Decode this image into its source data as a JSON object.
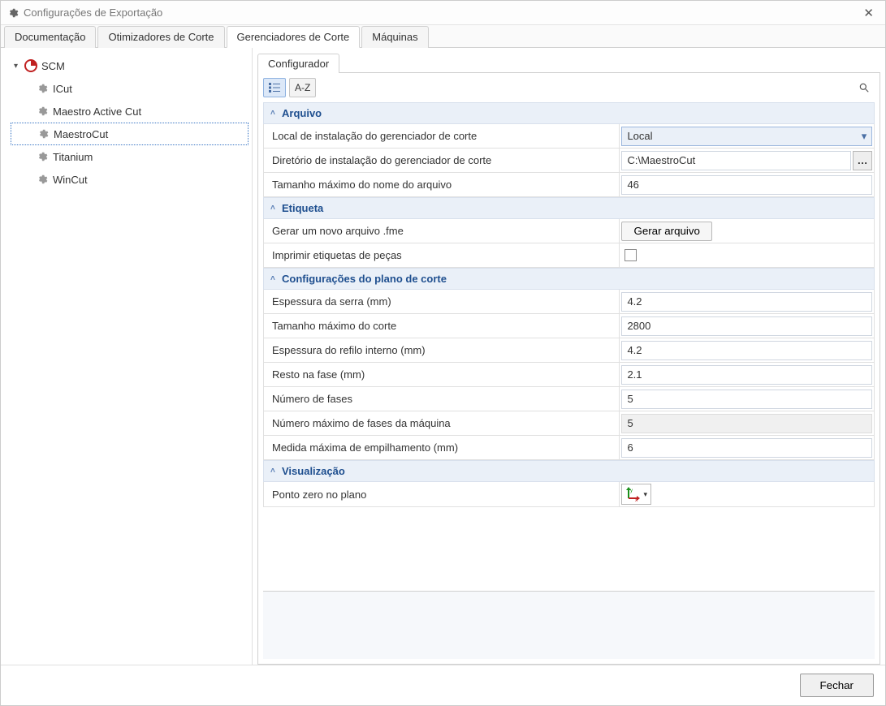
{
  "window": {
    "title": "Configurações de Exportação"
  },
  "tabs": {
    "main": [
      "Documentação",
      "Otimizadores de Corte",
      "Gerenciadores de Corte",
      "Máquinas"
    ],
    "activeIndex": 2
  },
  "tree": {
    "root": "SCM",
    "items": [
      "ICut",
      "Maestro Active Cut",
      "MaestroCut",
      "Titanium",
      "WinCut"
    ],
    "selectedIndex": 2
  },
  "subtab": {
    "label": "Configurador"
  },
  "toolbar": {
    "sort_az": "A-Z"
  },
  "groups": {
    "arquivo": {
      "title": "Arquivo",
      "local_label": "Local de instalação do gerenciador de corte",
      "local_value": "Local",
      "dir_label": "Diretório de instalação do gerenciador de corte",
      "dir_value": "C:\\MaestroCut",
      "maxname_label": "Tamanho máximo do nome do arquivo",
      "maxname_value": "46"
    },
    "etiqueta": {
      "title": "Etiqueta",
      "gen_label": "Gerar um novo arquivo .fme",
      "gen_button": "Gerar arquivo",
      "print_label": "Imprimir etiquetas de peças"
    },
    "plano": {
      "title": "Configurações do plano de corte",
      "saw_label": "Espessura da serra (mm)",
      "saw_value": "4.2",
      "maxcut_label": "Tamanho máximo do corte",
      "maxcut_value": "2800",
      "refilo_label": "Espessura do refilo interno (mm)",
      "refilo_value": "4.2",
      "resto_label": "Resto na fase (mm)",
      "resto_value": "2.1",
      "fases_label": "Número de fases",
      "fases_value": "5",
      "maxfases_label": "Número máximo de fases da máquina",
      "maxfases_value": "5",
      "empil_label": "Medida máxima de empilhamento (mm)",
      "empil_value": "6"
    },
    "visual": {
      "title": "Visualização",
      "zero_label": "Ponto zero no plano"
    }
  },
  "footer": {
    "close": "Fechar"
  }
}
